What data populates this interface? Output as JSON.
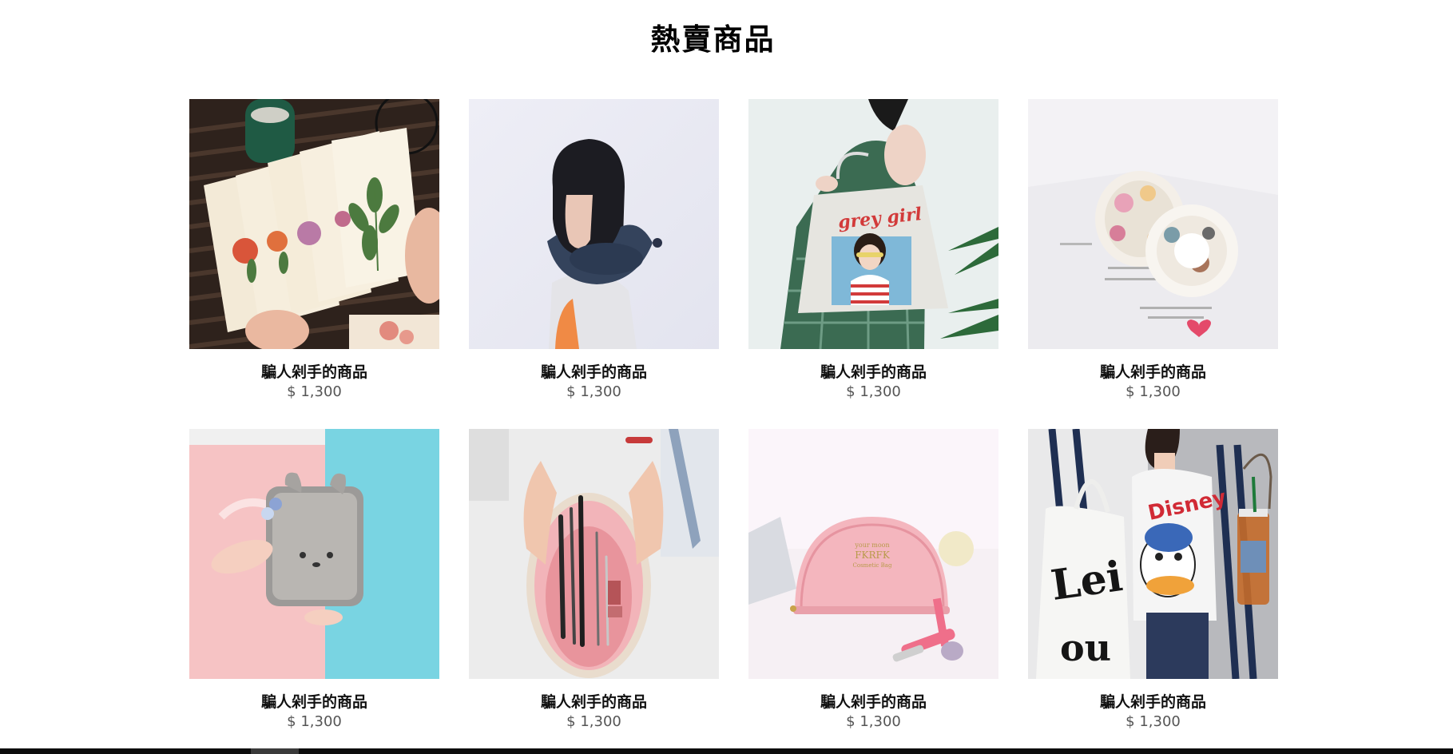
{
  "section": {
    "title": "熱賣商品"
  },
  "products": [
    {
      "name": "騙人剁手的商品",
      "price": "$ 1,300",
      "image": "botanical-postcards-image"
    },
    {
      "name": "騙人剁手的商品",
      "price": "$ 1,300",
      "image": "neck-pillow-image"
    },
    {
      "name": "騙人剁手的商品",
      "price": "$ 1,300",
      "image": "tote-bag-image"
    },
    {
      "name": "騙人剁手的商品",
      "price": "$ 1,300",
      "image": "washi-tape-image"
    },
    {
      "name": "騙人剁手的商品",
      "price": "$ 1,300",
      "image": "bear-pouch-image"
    },
    {
      "name": "騙人剁手的商品",
      "price": "$ 1,300",
      "image": "pencil-case-image"
    },
    {
      "name": "騙人剁手的商品",
      "price": "$ 1,300",
      "image": "cosmetic-bag-image"
    },
    {
      "name": "騙人剁手的商品",
      "price": "$ 1,300",
      "image": "canvas-bag-image"
    }
  ],
  "image_text": {
    "tote": "grey girl",
    "cosmetic_line1": "your moon",
    "cosmetic_line2": "FKRFK",
    "cosmetic_line3": "Cosmetic Bag",
    "shirt": "Disney"
  }
}
